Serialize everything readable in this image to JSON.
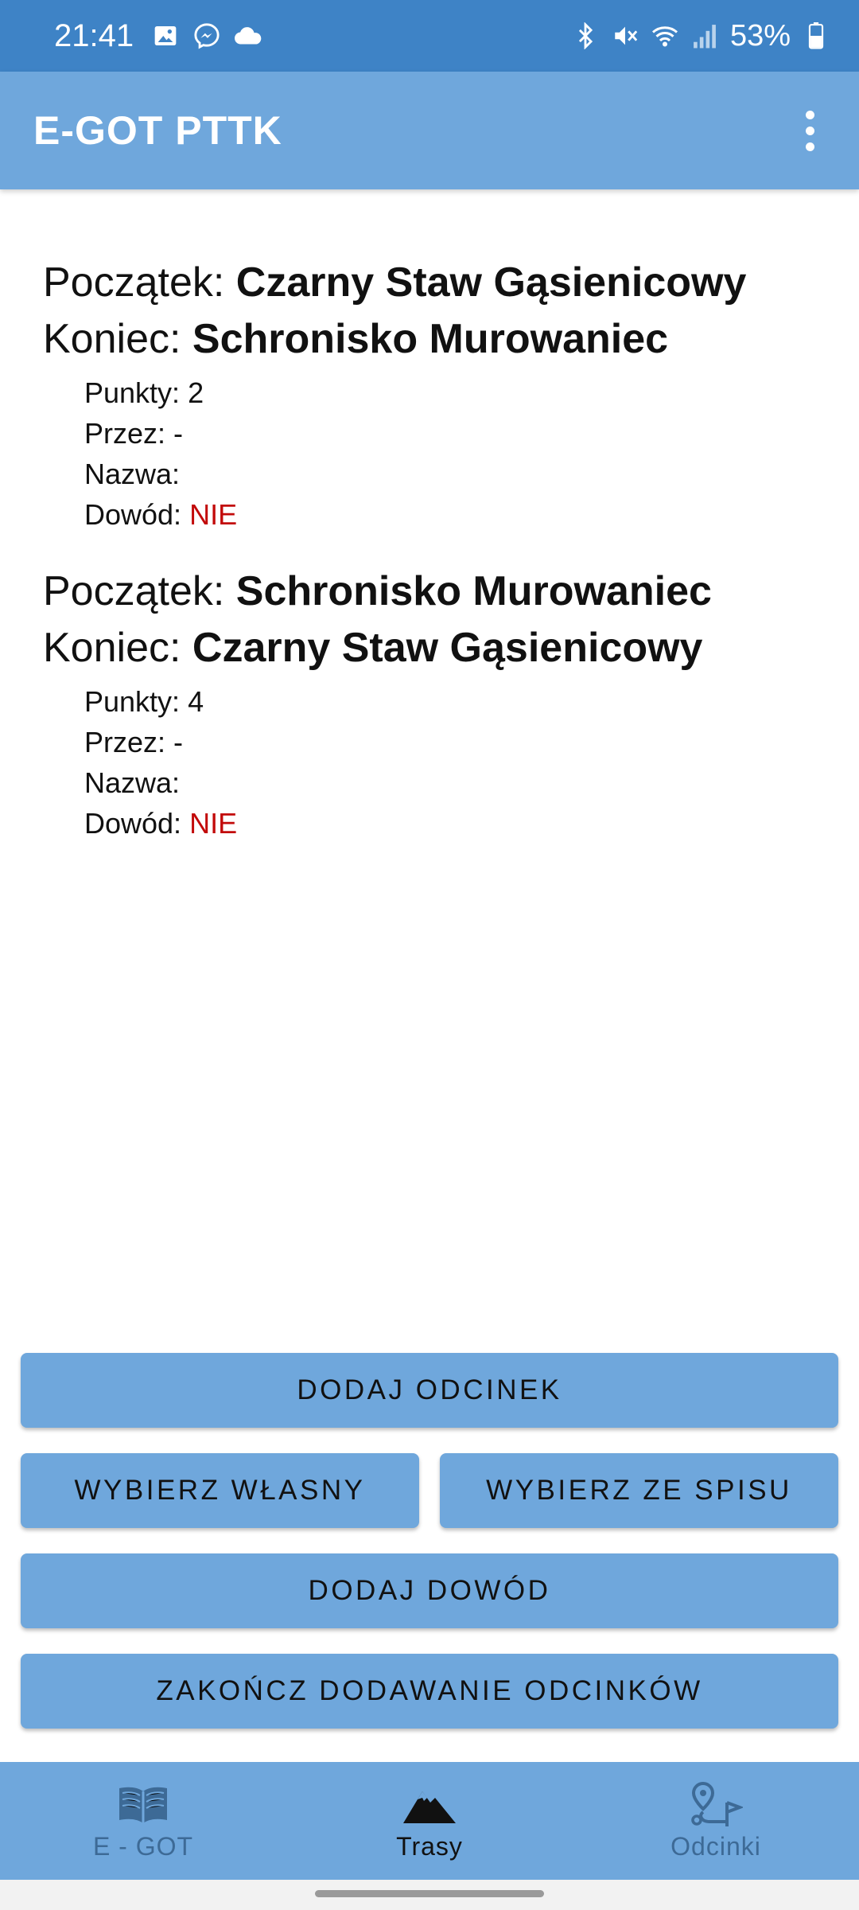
{
  "status_bar": {
    "time": "21:41",
    "left_icons": [
      "image-icon",
      "messenger-icon",
      "cloud-icon"
    ],
    "right_icons": [
      "bluetooth-icon",
      "mute-icon",
      "wifi-icon",
      "signal-icon"
    ],
    "battery_percent": "53%"
  },
  "app_bar": {
    "title": "E-GOT PTTK",
    "menu_icon": "more-vertical-icon"
  },
  "segments": [
    {
      "start_label": "Początek:",
      "start_value": "Czarny Staw Gąsienicowy",
      "end_label": "Koniec:",
      "end_value": "Schronisko Murowaniec",
      "points_label": "Punkty:",
      "points_value": "2",
      "via_label": "Przez:",
      "via_value": "-",
      "name_label": "Nazwa:",
      "name_value": "",
      "proof_label": "Dowód:",
      "proof_value": "NIE"
    },
    {
      "start_label": "Początek:",
      "start_value": "Schronisko Murowaniec",
      "end_label": "Koniec:",
      "end_value": "Czarny Staw Gąsienicowy",
      "points_label": "Punkty:",
      "points_value": "4",
      "via_label": "Przez:",
      "via_value": "-",
      "name_label": "Nazwa:",
      "name_value": "",
      "proof_label": "Dowód:",
      "proof_value": "NIE"
    }
  ],
  "actions": {
    "add_segment": "DODAJ ODCINEK",
    "choose_own": "WYBIERZ WŁASNY",
    "choose_from_list": "WYBIERZ ZE SPISU",
    "add_proof": "DODAJ DOWÓD",
    "finish_adding": "ZAKOŃCZ DODAWANIE ODCINKÓW"
  },
  "bottom_nav": {
    "items": [
      {
        "label": "E - GOT",
        "icon": "book-icon",
        "active": false
      },
      {
        "label": "Trasy",
        "icon": "mountain-icon",
        "active": true
      },
      {
        "label": "Odcinki",
        "icon": "route-icon",
        "active": false
      }
    ]
  },
  "colors": {
    "status_bar": "#3e83c6",
    "primary": "#6fa7dc",
    "negative_value": "#c20a0a",
    "nav_inactive": "#3d6a96"
  }
}
